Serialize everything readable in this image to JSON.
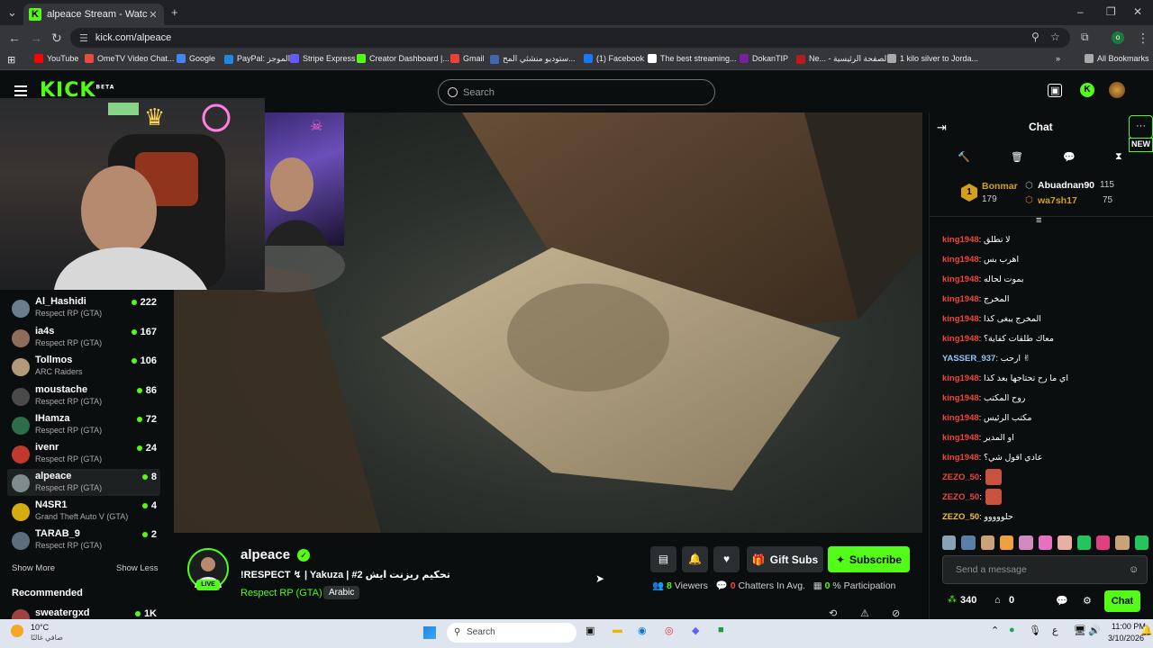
{
  "browser": {
    "tab_title": "alpeace Stream - Watch Live on",
    "tab_close": "✕",
    "new_tab": "+",
    "url": "kick.com/alpeace",
    "bookmarks": [
      {
        "label": "YouTube",
        "color": "#ff0000"
      },
      {
        "label": "OmeTV Video Chat...",
        "color": "#e74c3c"
      },
      {
        "label": "Google",
        "color": "#4285f4"
      },
      {
        "label": "PayPal: الموجز",
        "color": "#1e88e5"
      },
      {
        "label": "Stripe Express",
        "color": "#635bff"
      },
      {
        "label": "Creator Dashboard |...",
        "color": "#53fc18"
      },
      {
        "label": "Gmail",
        "color": "#ea4335"
      },
      {
        "label": "ستوديو منشئي المح...",
        "color": "#4267b2"
      },
      {
        "label": "(1) Facebook",
        "color": "#1877f2"
      },
      {
        "label": "The best streaming...",
        "color": "#ffffff"
      },
      {
        "label": "DokanTIP",
        "color": "#7a1fa2"
      },
      {
        "label": "Ne... - الصفحة الرئيسية",
        "color": "#b71c1c"
      },
      {
        "label": "1 kilo silver to Jorda...",
        "color": "#aaaaaa"
      }
    ],
    "all_bookmarks": "All Bookmarks"
  },
  "kick": {
    "logo": "KICK",
    "logo_beta": "BETA",
    "search_placeholder": "Search",
    "accent": "#53fc18"
  },
  "sidebar": {
    "channels": [
      {
        "name": "Al_Hashidi",
        "game": "Respect RP (GTA)",
        "viewers": "222",
        "avatar": "#6b7d8f"
      },
      {
        "name": "ia4s",
        "game": "Respect RP (GTA)",
        "viewers": "167",
        "avatar": "#8f6b5a"
      },
      {
        "name": "Tollmos",
        "game": "ARC Raiders",
        "viewers": "106",
        "avatar": "#b09a7a"
      },
      {
        "name": "moustache",
        "game": "Respect RP (GTA)",
        "viewers": "86",
        "avatar": "#4a4a4a"
      },
      {
        "name": "IHamza",
        "game": "Respect RP (GTA)",
        "viewers": "72",
        "avatar": "#2c6e49"
      },
      {
        "name": "ivenr",
        "game": "Respect RP (GTA)",
        "viewers": "24",
        "avatar": "#c0392b"
      },
      {
        "name": "alpeace",
        "game": "Respect RP (GTA)",
        "viewers": "8",
        "avatar": "#7f8c8d"
      },
      {
        "name": "N4SR1",
        "game": "Grand Theft Auto V (GTA)",
        "viewers": "4",
        "avatar": "#d4ac0d"
      },
      {
        "name": "TARAB_9",
        "game": "Respect RP (GTA)",
        "viewers": "2",
        "avatar": "#5d6d7e"
      }
    ],
    "show_more": "Show More",
    "show_less": "Show Less",
    "recommended": "Recommended",
    "rec_channel": {
      "name": "sweatergxd",
      "viewers": "1K"
    }
  },
  "stream": {
    "channel": "alpeace",
    "live": "LIVE",
    "title": "!RESPECT ↯ | Yakuza | #2 تحكيم ريزنت ايش",
    "category": "Respect RP (GTA)",
    "language": "Arabic",
    "gift_subs": "Gift Subs",
    "subscribe": "Subscribe",
    "viewers_count": "8",
    "viewers_label": "Viewers",
    "chatters_count": "0",
    "chatters_label": "Chatters In Avg.",
    "participation_count": "0",
    "participation_label": "% Participation"
  },
  "chat": {
    "title": "Chat",
    "new_badge": "NEW",
    "leaderboard": {
      "first": {
        "name": "Bonmar",
        "count": "179"
      },
      "second": {
        "name": "Abuadnan90",
        "count": "115"
      },
      "third": {
        "name": "wa7sh17",
        "count": "75"
      }
    },
    "messages": [
      {
        "user": "king1948",
        "text": "لا تطلق",
        "color": "#f0443a",
        "emote": false
      },
      {
        "user": "king1948",
        "text": "اهرب بس",
        "color": "#f0443a",
        "emote": false
      },
      {
        "user": "king1948",
        "text": "بموت لحاله",
        "color": "#f0443a",
        "emote": false
      },
      {
        "user": "king1948",
        "text": "المخرج",
        "color": "#f0443a",
        "emote": false
      },
      {
        "user": "king1948",
        "text": "المخرج يبغى كذا",
        "color": "#f0443a",
        "emote": false
      },
      {
        "user": "king1948",
        "text": "معاك طلقات كفاية؟",
        "color": "#f0443a",
        "emote": false
      },
      {
        "user": "YASSER_937",
        "text": "ارحب ✌",
        "color": "#93c5fd",
        "emote": false
      },
      {
        "user": "king1948",
        "text": "اي ما رح تحتاجها بعد كذا",
        "color": "#f0443a",
        "emote": false
      },
      {
        "user": "king1948",
        "text": "روح المكتب",
        "color": "#f0443a",
        "emote": false
      },
      {
        "user": "king1948",
        "text": "مكتب الرئيس",
        "color": "#f0443a",
        "emote": false
      },
      {
        "user": "king1948",
        "text": "او المدير",
        "color": "#f0443a",
        "emote": false
      },
      {
        "user": "king1948",
        "text": "عادي اقول شي؟",
        "color": "#f0443a",
        "emote": false
      },
      {
        "user": "ZEZO_50",
        "text": "",
        "color": "#f0443a",
        "emote": true
      },
      {
        "user": "ZEZO_50",
        "text": "",
        "color": "#f0443a",
        "emote": true
      },
      {
        "user": "ZEZO_50",
        "text": "حلووووو",
        "color": "#fbbf24",
        "emote": false
      }
    ],
    "input_placeholder": "Send a message",
    "points": "340",
    "gifts": "0",
    "send_label": "Chat"
  },
  "taskbar": {
    "weather_temp": "10°C",
    "weather_desc": "صافي غالبًا",
    "search_label": "Search",
    "time": "11:00 PM",
    "date": "3/10/2026",
    "lang": "ع"
  }
}
